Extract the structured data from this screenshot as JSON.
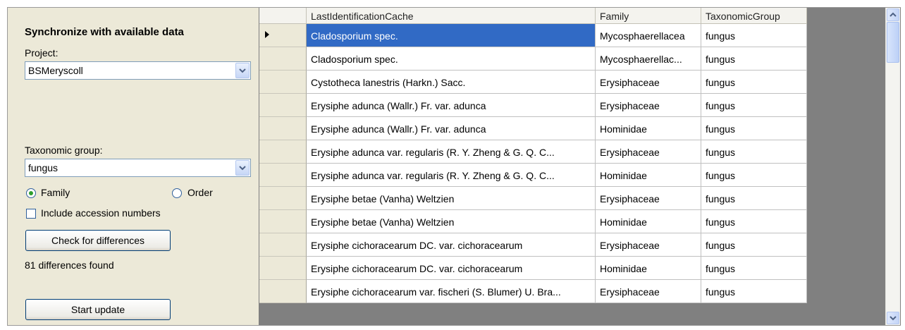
{
  "sync": {
    "title": "Synchronize with available data",
    "project_label": "Project:",
    "project_value": "BSMeryscoll",
    "taxgroup_label": "Taxonomic group:",
    "taxgroup_value": "fungus",
    "radio_family": "Family",
    "radio_order": "Order",
    "include_accession_label": "Include accession numbers",
    "check_button": "Check for differences",
    "differences_text": "81 differences found",
    "start_button": "Start update"
  },
  "grid": {
    "columns": [
      "LastIdentificationCache",
      "Family",
      "TaxonomicGroup"
    ],
    "rows": [
      [
        "Cladosporium spec.",
        "Mycosphaerellacea",
        "fungus"
      ],
      [
        "Cladosporium spec.",
        "Mycosphaerellac...",
        "fungus"
      ],
      [
        "Cystotheca lanestris (Harkn.) Sacc.",
        "Erysiphaceae",
        "fungus"
      ],
      [
        "Erysiphe adunca (Wallr.) Fr. var. adunca",
        "Erysiphaceae",
        "fungus"
      ],
      [
        "Erysiphe adunca (Wallr.) Fr. var. adunca",
        "Hominidae",
        "fungus"
      ],
      [
        "Erysiphe adunca var. regularis (R. Y. Zheng & G. Q. C...",
        "Erysiphaceae",
        "fungus"
      ],
      [
        "Erysiphe adunca var. regularis (R. Y. Zheng & G. Q. C...",
        "Hominidae",
        "fungus"
      ],
      [
        "Erysiphe betae (Vanha) Weltzien",
        "Erysiphaceae",
        "fungus"
      ],
      [
        "Erysiphe betae (Vanha) Weltzien",
        "Hominidae",
        "fungus"
      ],
      [
        "Erysiphe cichoracearum DC. var. cichoracearum",
        "Erysiphaceae",
        "fungus"
      ],
      [
        "Erysiphe cichoracearum DC. var. cichoracearum",
        "Hominidae",
        "fungus"
      ],
      [
        "Erysiphe cichoracearum var. fischeri (S. Blumer) U. Bra...",
        "Erysiphaceae",
        "fungus"
      ]
    ]
  }
}
